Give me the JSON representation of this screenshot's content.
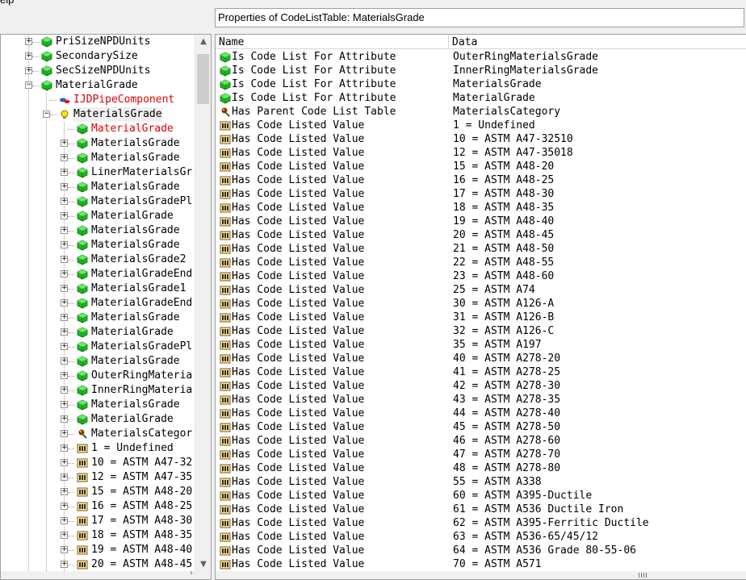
{
  "window": {
    "menu_fragment": "elp"
  },
  "properties_panel": {
    "title": "Properties of CodeListTable: MaterialsGrade"
  },
  "columns": {
    "name": "Name",
    "data": "Data"
  },
  "tree": {
    "nodes": [
      {
        "label": "PriSizeNPDUnits",
        "level": 0,
        "expander": "+",
        "icon": "cube",
        "lineLast": false
      },
      {
        "label": "SecondarySize",
        "level": 0,
        "expander": "+",
        "icon": "cube",
        "lineLast": false
      },
      {
        "label": "SecSizeNPDUnits",
        "level": 0,
        "expander": "+",
        "icon": "cube",
        "lineLast": false
      },
      {
        "label": "MaterialGrade",
        "level": 0,
        "expander": "−",
        "icon": "cube",
        "lineLast": false
      },
      {
        "label": "IJDPipeComponent",
        "level": 1,
        "expander": "",
        "icon": "link",
        "color": "red"
      },
      {
        "label": "MaterialsGrade",
        "level": 1,
        "expander": "−",
        "icon": "bulb",
        "selected": true
      },
      {
        "label": "MaterialGrade",
        "level": 2,
        "expander": "",
        "icon": "cube",
        "color": "red"
      },
      {
        "label": "MaterialsGrade",
        "level": 2,
        "expander": "+",
        "icon": "cube"
      },
      {
        "label": "MaterialsGrade",
        "level": 2,
        "expander": "+",
        "icon": "cube"
      },
      {
        "label": "LinerMaterialsGr",
        "level": 2,
        "expander": "+",
        "icon": "cube"
      },
      {
        "label": "MaterialsGrade",
        "level": 2,
        "expander": "+",
        "icon": "cube"
      },
      {
        "label": "MaterialsGradePl",
        "level": 2,
        "expander": "+",
        "icon": "cube"
      },
      {
        "label": "MaterialGrade",
        "level": 2,
        "expander": "+",
        "icon": "cube"
      },
      {
        "label": "MaterialsGrade",
        "level": 2,
        "expander": "+",
        "icon": "cube"
      },
      {
        "label": "MaterialsGrade",
        "level": 2,
        "expander": "+",
        "icon": "cube"
      },
      {
        "label": "MaterialsGrade2",
        "level": 2,
        "expander": "+",
        "icon": "cube"
      },
      {
        "label": "MaterialGradeEnd",
        "level": 2,
        "expander": "+",
        "icon": "cube"
      },
      {
        "label": "MaterialsGrade1",
        "level": 2,
        "expander": "+",
        "icon": "cube"
      },
      {
        "label": "MaterialGradeEnd",
        "level": 2,
        "expander": "+",
        "icon": "cube"
      },
      {
        "label": "MaterialsGrade",
        "level": 2,
        "expander": "+",
        "icon": "cube"
      },
      {
        "label": "MaterialGrade",
        "level": 2,
        "expander": "+",
        "icon": "cube"
      },
      {
        "label": "MaterialsGradePl",
        "level": 2,
        "expander": "+",
        "icon": "cube"
      },
      {
        "label": "MaterialsGrade",
        "level": 2,
        "expander": "+",
        "icon": "cube"
      },
      {
        "label": "OuterRingMateria",
        "level": 2,
        "expander": "+",
        "icon": "cube"
      },
      {
        "label": "InnerRingMateria",
        "level": 2,
        "expander": "+",
        "icon": "cube"
      },
      {
        "label": "MaterialsGrade",
        "level": 2,
        "expander": "+",
        "icon": "cube"
      },
      {
        "label": "MaterialGrade",
        "level": 2,
        "expander": "+",
        "icon": "cube"
      },
      {
        "label": "MaterialsCategor",
        "level": 2,
        "expander": "+",
        "icon": "pin"
      },
      {
        "label": "1 = Undefined",
        "level": 2,
        "expander": "+",
        "icon": "dif"
      },
      {
        "label": "10 = ASTM A47-32",
        "level": 2,
        "expander": "+",
        "icon": "dif"
      },
      {
        "label": "12 = ASTM A47-35",
        "level": 2,
        "expander": "+",
        "icon": "dif"
      },
      {
        "label": "15 = ASTM A48-20",
        "level": 2,
        "expander": "+",
        "icon": "dif"
      },
      {
        "label": "16 = ASTM A48-25",
        "level": 2,
        "expander": "+",
        "icon": "dif"
      },
      {
        "label": "17 = ASTM A48-30",
        "level": 2,
        "expander": "+",
        "icon": "dif"
      },
      {
        "label": "18 = ASTM A48-35",
        "level": 2,
        "expander": "+",
        "icon": "dif"
      },
      {
        "label": "19 = ASTM A48-40",
        "level": 2,
        "expander": "+",
        "icon": "dif"
      },
      {
        "label": "20 = ASTM A48-45",
        "level": 2,
        "expander": "+",
        "icon": "dif"
      }
    ]
  },
  "properties": [
    {
      "icon": "cube",
      "name": "Is Code List For Attribute",
      "value": "OuterRingMaterialsGrade"
    },
    {
      "icon": "cube",
      "name": "Is Code List For Attribute",
      "value": "InnerRingMaterialsGrade"
    },
    {
      "icon": "cube",
      "name": "Is Code List For Attribute",
      "value": "MaterialsGrade"
    },
    {
      "icon": "cube",
      "name": "Is Code List For Attribute",
      "value": "MaterialGrade"
    },
    {
      "icon": "pin",
      "name": "Has Parent Code List Table",
      "value": "MaterialsCategory"
    },
    {
      "icon": "dif",
      "name": "Has Code Listed Value",
      "value": "1 = Undefined"
    },
    {
      "icon": "dif",
      "name": "Has Code Listed Value",
      "value": "10 = ASTM A47-32510"
    },
    {
      "icon": "dif",
      "name": "Has Code Listed Value",
      "value": "12 = ASTM A47-35018"
    },
    {
      "icon": "dif",
      "name": "Has Code Listed Value",
      "value": "15 = ASTM A48-20"
    },
    {
      "icon": "dif",
      "name": "Has Code Listed Value",
      "value": "16 = ASTM A48-25"
    },
    {
      "icon": "dif",
      "name": "Has Code Listed Value",
      "value": "17 = ASTM A48-30"
    },
    {
      "icon": "dif",
      "name": "Has Code Listed Value",
      "value": "18 = ASTM A48-35"
    },
    {
      "icon": "dif",
      "name": "Has Code Listed Value",
      "value": "19 = ASTM A48-40"
    },
    {
      "icon": "dif",
      "name": "Has Code Listed Value",
      "value": "20 = ASTM A48-45"
    },
    {
      "icon": "dif",
      "name": "Has Code Listed Value",
      "value": "21 = ASTM A48-50"
    },
    {
      "icon": "dif",
      "name": "Has Code Listed Value",
      "value": "22 = ASTM A48-55"
    },
    {
      "icon": "dif",
      "name": "Has Code Listed Value",
      "value": "23 = ASTM A48-60"
    },
    {
      "icon": "dif",
      "name": "Has Code Listed Value",
      "value": "25 = ASTM A74"
    },
    {
      "icon": "dif",
      "name": "Has Code Listed Value",
      "value": "30 = ASTM A126-A"
    },
    {
      "icon": "dif",
      "name": "Has Code Listed Value",
      "value": "31 = ASTM A126-B"
    },
    {
      "icon": "dif",
      "name": "Has Code Listed Value",
      "value": "32 = ASTM A126-C"
    },
    {
      "icon": "dif",
      "name": "Has Code Listed Value",
      "value": "35 = ASTM A197"
    },
    {
      "icon": "dif",
      "name": "Has Code Listed Value",
      "value": "40 = ASTM A278-20"
    },
    {
      "icon": "dif",
      "name": "Has Code Listed Value",
      "value": "41 = ASTM A278-25"
    },
    {
      "icon": "dif",
      "name": "Has Code Listed Value",
      "value": "42 = ASTM A278-30"
    },
    {
      "icon": "dif",
      "name": "Has Code Listed Value",
      "value": "43 = ASTM A278-35"
    },
    {
      "icon": "dif",
      "name": "Has Code Listed Value",
      "value": "44 = ASTM A278-40"
    },
    {
      "icon": "dif",
      "name": "Has Code Listed Value",
      "value": "45 = ASTM A278-50"
    },
    {
      "icon": "dif",
      "name": "Has Code Listed Value",
      "value": "46 = ASTM A278-60"
    },
    {
      "icon": "dif",
      "name": "Has Code Listed Value",
      "value": "47 = ASTM A278-70"
    },
    {
      "icon": "dif",
      "name": "Has Code Listed Value",
      "value": "48 = ASTM A278-80"
    },
    {
      "icon": "dif",
      "name": "Has Code Listed Value",
      "value": "55 = ASTM A338"
    },
    {
      "icon": "dif",
      "name": "Has Code Listed Value",
      "value": "60 = ASTM A395-Ductile"
    },
    {
      "icon": "dif",
      "name": "Has Code Listed Value",
      "value": "61 = ASTM A536 Ductile Iron"
    },
    {
      "icon": "dif",
      "name": "Has Code Listed Value",
      "value": "62 = ASTM A395-Ferritic Ductile"
    },
    {
      "icon": "dif",
      "name": "Has Code Listed Value",
      "value": "63 = ASTM A536-65/45/12"
    },
    {
      "icon": "dif",
      "name": "Has Code Listed Value",
      "value": "64 = ASTM A536 Grade 80-55-06"
    },
    {
      "icon": "dif",
      "name": "Has Code Listed Value",
      "value": "70 = ASTM A571"
    }
  ],
  "colors": {
    "cube": "#1db51d",
    "red_text": "#e00000",
    "dif_icon": "#7a5a1a"
  }
}
